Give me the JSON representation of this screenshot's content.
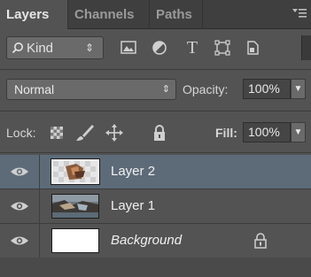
{
  "tabs": [
    {
      "label": "Layers",
      "active": true
    },
    {
      "label": "Channels",
      "active": false
    },
    {
      "label": "Paths",
      "active": false
    }
  ],
  "filter": {
    "kind_label": "Kind",
    "kind_arrow": "⇕",
    "type_glyph": "T",
    "icons": [
      "pixel-filter-icon",
      "adjustment-filter-icon",
      "type-filter-icon",
      "shape-filter-icon",
      "smart-object-filter-icon"
    ]
  },
  "blend": {
    "mode": "Normal",
    "mode_arrow": "⇕",
    "opacity_label": "Opacity:",
    "opacity_value": "100%"
  },
  "lock": {
    "label": "Lock:",
    "fill_label": "Fill:",
    "fill_value": "100%",
    "icons": [
      "lock-transparent-icon",
      "lock-image-icon",
      "lock-position-icon",
      "lock-all-icon"
    ]
  },
  "layers": [
    {
      "name": "Layer 2",
      "selected": true,
      "visible": true
    },
    {
      "name": "Layer 1",
      "selected": false,
      "visible": true
    },
    {
      "name": "Background",
      "selected": false,
      "visible": true,
      "locked": true
    }
  ],
  "colors": {
    "panel": "#535353",
    "tabbar": "#3f3f3f",
    "selected_row": "#5d6b79"
  }
}
